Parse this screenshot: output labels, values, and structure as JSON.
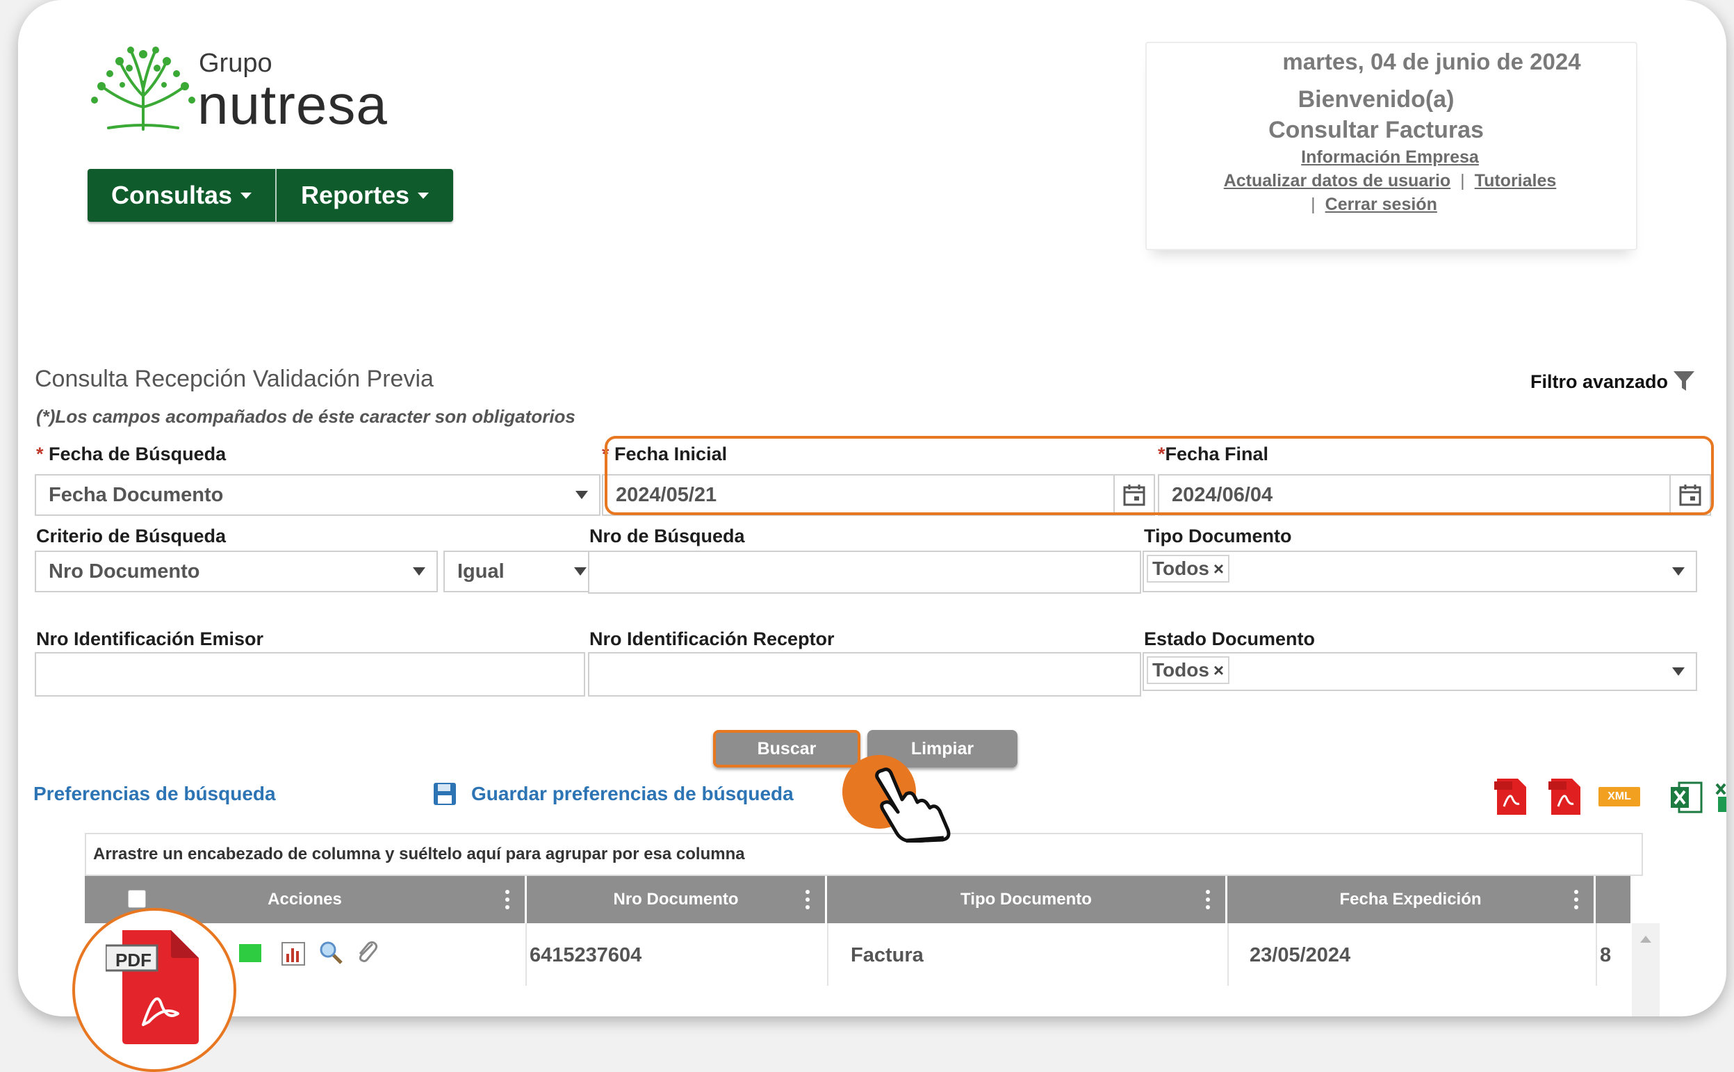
{
  "brand": {
    "group": "Grupo",
    "name": "nutresa",
    "green": "#0f5b2c",
    "accent": "#e87722"
  },
  "nav": {
    "items": [
      {
        "label": "Consultas"
      },
      {
        "label": "Reportes"
      }
    ]
  },
  "user_panel": {
    "date": "martes, 04 de junio de 2024",
    "welcome": "Bienvenido(a)",
    "module": "Consultar Facturas",
    "company_info": "Información Empresa",
    "update_user": "Actualizar datos de usuario",
    "tutorials": "Tutoriales",
    "logout": "Cerrar sesión",
    "separator": "|"
  },
  "page": {
    "title": "Consulta Recepción Validación Previa",
    "required_note": "(*)Los campos acompañados de éste caracter son obligatorios",
    "advanced_filter": "Filtro avanzado"
  },
  "form": {
    "search_date": {
      "label": "Fecha de Búsqueda",
      "value": "Fecha Documento"
    },
    "start_date": {
      "label": "Fecha Inicial",
      "value": "2024/05/21"
    },
    "end_date": {
      "label": "Fecha Final",
      "value": "2024/06/04"
    },
    "criteria": {
      "label": "Criterio de Búsqueda",
      "value": "Nro Documento",
      "operator": "Igual"
    },
    "search_number": {
      "label": "Nro de Búsqueda",
      "value": ""
    },
    "doc_type": {
      "label": "Tipo Documento",
      "tag": "Todos"
    },
    "issuer_id": {
      "label": "Nro Identificación Emisor",
      "value": ""
    },
    "receiver_id": {
      "label": "Nro Identificación Receptor",
      "value": ""
    },
    "doc_status": {
      "label": "Estado Documento",
      "tag": "Todos"
    },
    "asterisk": "*",
    "tag_remove": "×"
  },
  "buttons": {
    "search": " Buscar",
    "clear": " Limpiar"
  },
  "preferences": {
    "search_prefs": "Preferencias de búsqueda",
    "save_prefs": "Guardar preferencias de búsqueda"
  },
  "exports": {
    "xml": "XML",
    "pdf": "PDF"
  },
  "grid": {
    "group_hint": "Arrastre un encabezado de columna y suéltelo aquí para agrupar por esa columna",
    "columns": [
      "Acciones",
      "Nro Documento",
      "Tipo Documento",
      "Fecha Expedición"
    ],
    "rows": [
      {
        "nro_documento": "6415237604",
        "tipo_documento": "Factura",
        "fecha_expedicion": "23/05/2024",
        "next_col_partial": "8"
      }
    ]
  }
}
